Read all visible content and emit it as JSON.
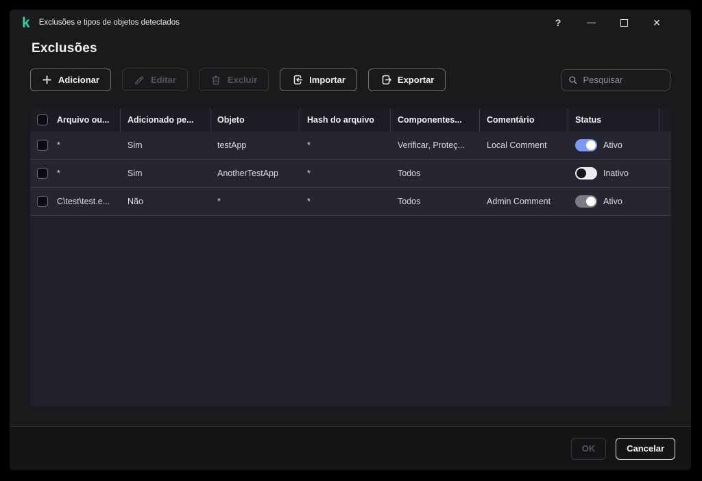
{
  "window": {
    "title": "Exclusões e tipos de objetos detectados",
    "controls": {
      "help": "?",
      "close": "✕"
    }
  },
  "page": {
    "title": "Exclusões"
  },
  "toolbar": {
    "add": "Adicionar",
    "edit": "Editar",
    "delete": "Excluir",
    "import": "Importar",
    "export": "Exportar",
    "search_placeholder": "Pesquisar"
  },
  "table": {
    "columns": {
      "file": "Arquivo ou...",
      "added_by": "Adicionado pe...",
      "object": "Objeto",
      "hash": "Hash do arquivo",
      "components": "Componentes...",
      "comment": "Comentário",
      "status": "Status"
    },
    "rows": [
      {
        "file": "*",
        "added_by": "Sim",
        "object": "testApp",
        "hash": "*",
        "components": "Verificar, Proteç...",
        "comment": "Local Comment",
        "status": "Ativo",
        "toggle": "on"
      },
      {
        "file": "*",
        "added_by": "Sim",
        "object": "AnotherTestApp",
        "hash": "*",
        "components": "Todos",
        "comment": "",
        "status": "Inativo",
        "toggle": "off"
      },
      {
        "file": "C\\test\\test.e...",
        "added_by": "Não",
        "object": "*",
        "hash": "*",
        "components": "Todos",
        "comment": "Admin Comment",
        "status": "Ativo",
        "toggle": "locked"
      }
    ]
  },
  "footer": {
    "ok": "OK",
    "cancel": "Cancelar"
  },
  "colors": {
    "brand_teal": "#2bd6a7",
    "toggle_active": "#7b99f4",
    "row_bg": "#262631",
    "window_bg": "#1a1a1d"
  }
}
